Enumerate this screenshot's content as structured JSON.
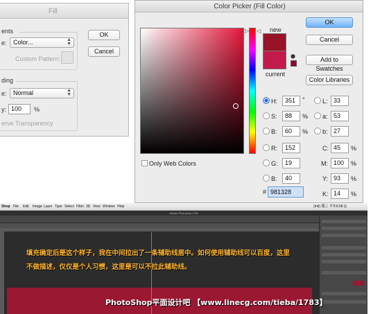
{
  "fill_dialog": {
    "title": "Fill",
    "contents_group": "ents",
    "use_label": "e:",
    "use_value": "Color...",
    "custom_pattern_label": "Custom Pattern:",
    "blending_group": "ding",
    "mode_label": "e:",
    "mode_value": "Normal",
    "opacity_label": "y:",
    "opacity_value": "100",
    "opacity_unit": "%",
    "preserve_transparency": "erve Transparency",
    "ok_label": "OK",
    "cancel_label": "Cancel"
  },
  "color_picker": {
    "title": "Color Picker (Fill Color)",
    "ok_label": "OK",
    "cancel_label": "Cancel",
    "add_to_swatches_label": "Add to Swatches",
    "color_libraries_label": "Color Libraries",
    "new_label": "new",
    "current_label": "current",
    "new_color": "#981328",
    "current_color": "#c21a4a",
    "websafe_color": "#990033",
    "only_web_colors_label": "Only Web Colors",
    "fields": {
      "h_label": "H:",
      "h_value": "351",
      "h_unit": "°",
      "s_label": "S:",
      "s_value": "88",
      "s_unit": "%",
      "b_label": "B:",
      "b_value": "60",
      "b_unit": "%",
      "r_label": "R:",
      "r_value": "152",
      "g_label": "G:",
      "g_value": "19",
      "bl_label": "B:",
      "bl_value": "40",
      "l_label": "L:",
      "l_value": "33",
      "a_label": "a:",
      "a_value": "53",
      "lab_b_label": "b:",
      "lab_b_value": "27",
      "c_label": "C:",
      "c_value": "45",
      "c_unit": "%",
      "m_label": "M:",
      "m_value": "100",
      "m_unit": "%",
      "y_label": "Y:",
      "y_value": "93",
      "y_unit": "%",
      "k_label": "K:",
      "k_value": "14",
      "k_unit": "%",
      "hex_label": "#",
      "hex_value": "981328"
    },
    "selected_mode": "H"
  },
  "photoshop": {
    "menu_items": [
      "Shop",
      "File",
      "Edit",
      "Image",
      "Layer",
      "Type",
      "Select",
      "Filter",
      "3D",
      "View",
      "Window",
      "Help"
    ],
    "status_text": "(Intl) 周二 下午6:58  Q",
    "window_title": "Adobe Photoshop CS6",
    "note_line1": "填充确定后是这个样子，我在中间拉出了一条辅助线居中。如何使用辅助线可以百度，这里",
    "note_line2": "不做描述，仅仅是个人习惯，这里是可以不拉此辅助线。",
    "watermark": "PhotoShop平面设计吧 【www.linecg.com/tieba/1783】",
    "band_color": "#9b1832"
  }
}
